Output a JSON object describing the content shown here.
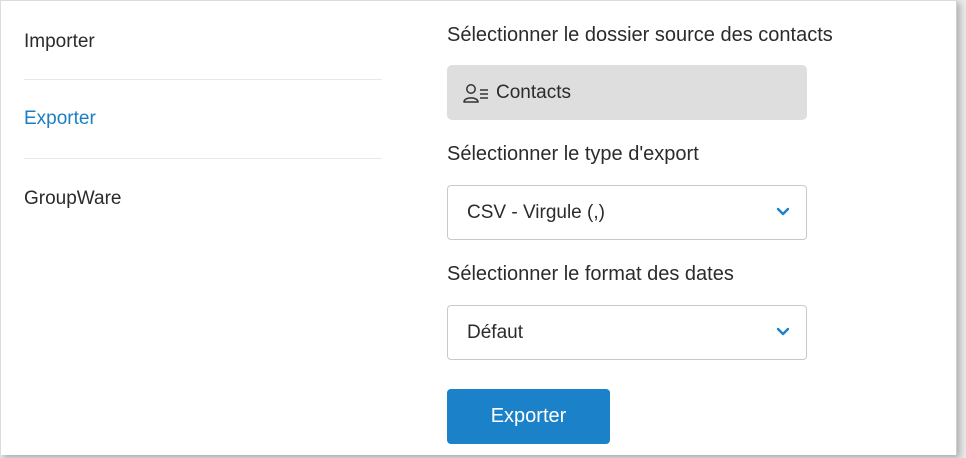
{
  "sidebar": {
    "items": [
      {
        "label": "Importer"
      },
      {
        "label": "Exporter"
      },
      {
        "label": "GroupWare"
      }
    ],
    "active_color": "#1b7fc4"
  },
  "export": {
    "source_label": "Sélectionner le dossier source des contacts",
    "source_value": "Contacts",
    "source_icon": "contact-list-icon",
    "type_label": "Sélectionner le type d'export",
    "type_value": "CSV - Virgule (,)",
    "date_label": "Sélectionner le format des dates",
    "date_value": "Défaut",
    "button_label": "Exporter",
    "accent_color": "#1b82c9"
  }
}
